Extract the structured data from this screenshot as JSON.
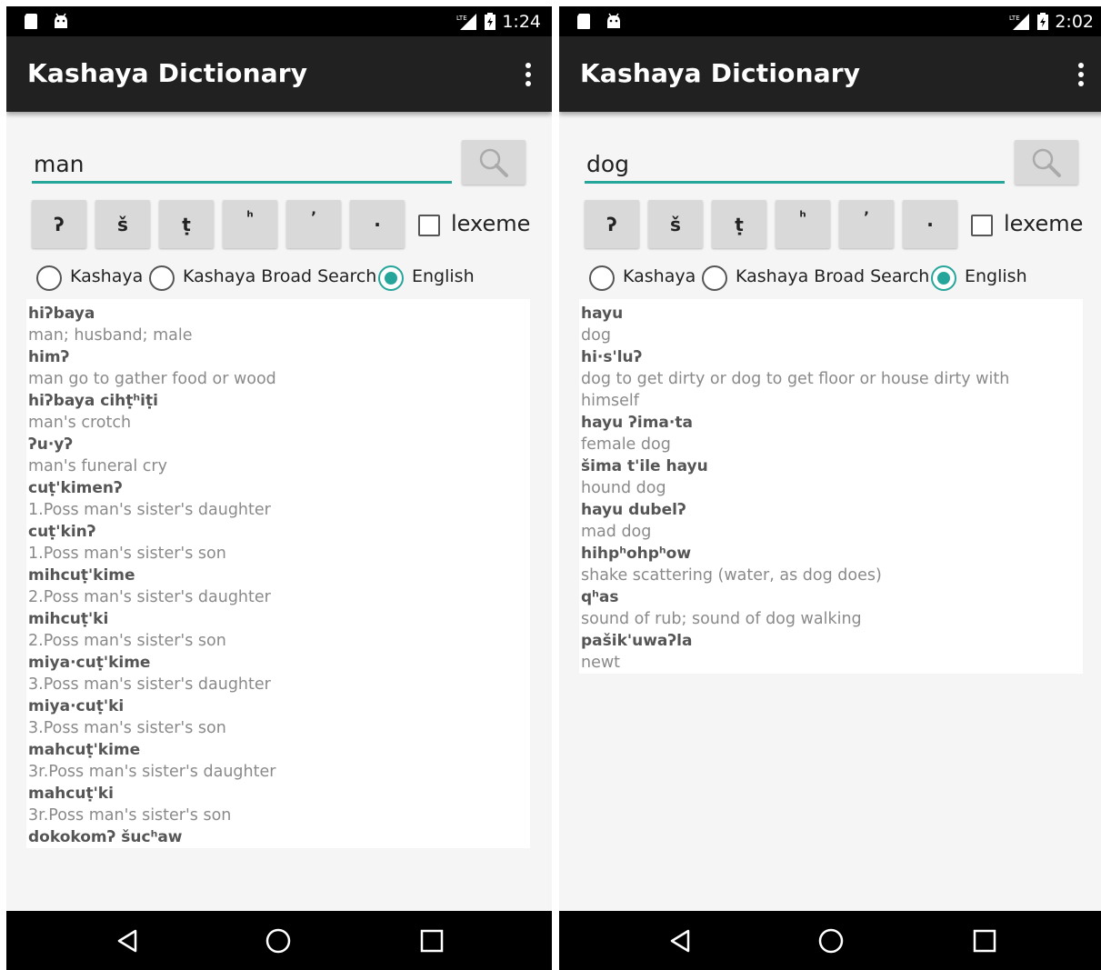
{
  "colors": {
    "accent": "#26a69a",
    "appbar": "#212121",
    "statusbar": "#000000",
    "button": "#d9d9d9"
  },
  "left": {
    "status_time": "1:24",
    "app_title": "Kashaya Dictionary",
    "search_value": "man",
    "char_buttons": [
      "ʔ",
      "š",
      "ṭ",
      "ʰ",
      "ʼ",
      "·"
    ],
    "lexeme_label": "lexeme",
    "radio_options": [
      "Kashaya",
      "Kashaya Broad Search",
      "English"
    ],
    "selected_radio": "English",
    "results": [
      {
        "word": "hiʔbaya",
        "gloss": "man; husband; male"
      },
      {
        "word": "himʔ",
        "gloss": "man go to gather food or wood"
      },
      {
        "word": "hiʔbaya cihṭʰiṭi",
        "gloss": "man's crotch"
      },
      {
        "word": "ʔu·yʔ",
        "gloss": "man's funeral cry"
      },
      {
        "word": "cuṭ'kimenʔ",
        "gloss": "1.Poss man's sister's daughter"
      },
      {
        "word": "cuṭ'kinʔ",
        "gloss": "1.Poss man's sister's son"
      },
      {
        "word": "mihcuṭ'kime",
        "gloss": "2.Poss man's sister's daughter"
      },
      {
        "word": "mihcuṭ'ki",
        "gloss": "2.Poss man's sister's son"
      },
      {
        "word": "miya·cuṭ'kime",
        "gloss": "3.Poss man's sister's daughter"
      },
      {
        "word": "miya·cuṭ'ki",
        "gloss": "3.Poss man's sister's son"
      },
      {
        "word": "mahcuṭ'kime",
        "gloss": "3r.Poss man's sister's daughter"
      },
      {
        "word": "mahcuṭ'ki",
        "gloss": "3r.Poss man's sister's son"
      },
      {
        "word": "dokokomʔ šucʰaw",
        "gloss": ""
      }
    ]
  },
  "right": {
    "status_time": "2:02",
    "app_title": "Kashaya Dictionary",
    "search_value": "dog",
    "char_buttons": [
      "ʔ",
      "š",
      "ṭ",
      "ʰ",
      "ʼ",
      "·"
    ],
    "lexeme_label": "lexeme",
    "radio_options": [
      "Kashaya",
      "Kashaya Broad Search",
      "English"
    ],
    "selected_radio": "English",
    "results": [
      {
        "word": "hayu",
        "gloss": "dog"
      },
      {
        "word": "hi·s'luʔ",
        "gloss": "dog to get dirty or dog to get floor or house dirty with himself"
      },
      {
        "word": "hayu ʔima·ta",
        "gloss": "female dog"
      },
      {
        "word": "šima t'ile hayu",
        "gloss": "hound dog"
      },
      {
        "word": "hayu dubelʔ",
        "gloss": "mad dog"
      },
      {
        "word": "hihpʰohpʰow",
        "gloss": "shake scattering (water, as dog does)"
      },
      {
        "word": "qʰas",
        "gloss": "sound of rub; sound of dog walking"
      },
      {
        "word": "pašik'uwaʔla",
        "gloss": "newt"
      }
    ]
  }
}
